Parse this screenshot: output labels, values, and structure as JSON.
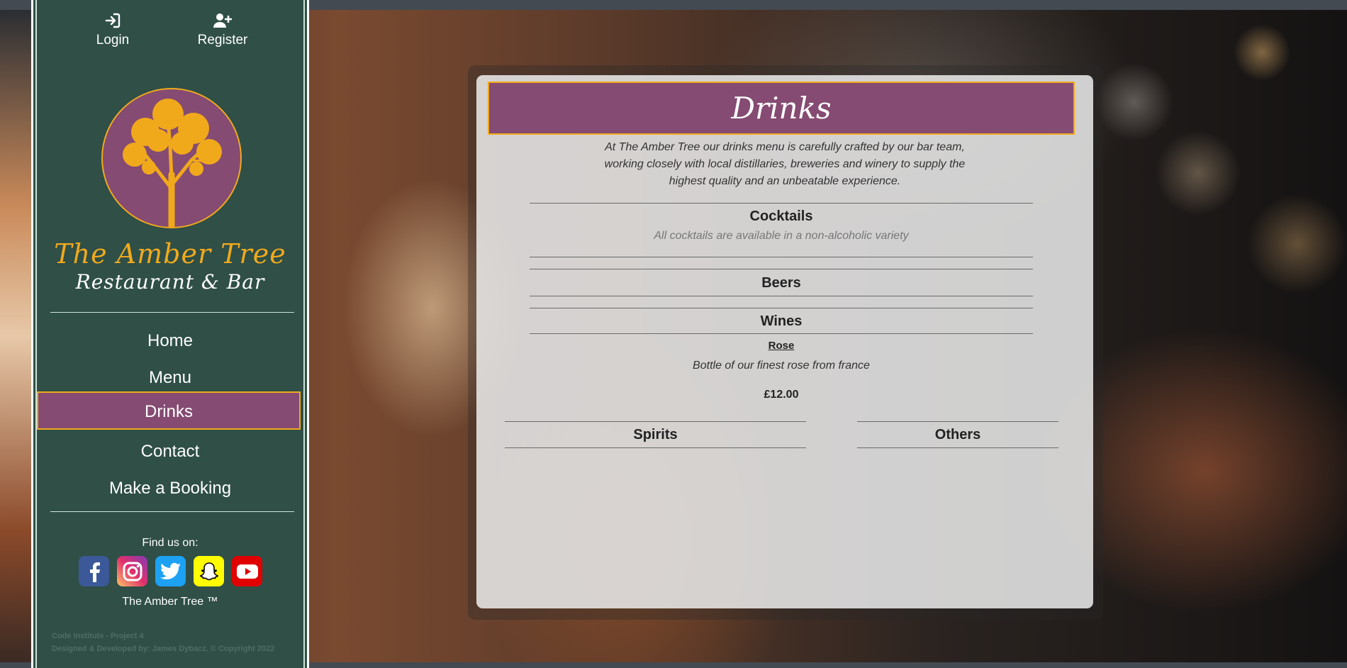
{
  "auth": {
    "login_label": "Login",
    "register_label": "Register"
  },
  "brand": {
    "name": "The Amber Tree",
    "subtitle": "Restaurant & Bar"
  },
  "nav": {
    "items": [
      {
        "label": "Home"
      },
      {
        "label": "Menu"
      },
      {
        "label": "Drinks",
        "active": true
      },
      {
        "label": "Contact"
      },
      {
        "label": "Make a Booking"
      }
    ]
  },
  "social": {
    "find_label": "Find us on:",
    "icons": [
      "facebook-icon",
      "instagram-icon",
      "twitter-icon",
      "snapchat-icon",
      "youtube-icon"
    ],
    "trademark": "The Amber Tree ™"
  },
  "footer": {
    "line1": "Code Institute - Project 4",
    "line2": "Designed & Developed by: James Dybacz. © Copyright 2022"
  },
  "colors": {
    "sidebar": "#2f4f47",
    "accent_purple": "#854b72",
    "accent_amber": "#f1a91c"
  },
  "main": {
    "title": "Drinks",
    "intro": "At The Amber Tree our drinks menu is carefully crafted by our bar team, working closely with local distillaries, breweries and winery to supply the highest quality and an unbeatable experience.",
    "sections": {
      "cocktails": {
        "title": "Cocktails",
        "note": "All cocktails are available in a non-alcoholic variety"
      },
      "beers": {
        "title": "Beers"
      },
      "wines": {
        "title": "Wines",
        "items": [
          {
            "name": "Rose",
            "description": "Bottle of our finest rose from france",
            "price": "£12.00"
          }
        ]
      },
      "spirits": {
        "title": "Spirits"
      },
      "others": {
        "title": "Others"
      }
    }
  }
}
